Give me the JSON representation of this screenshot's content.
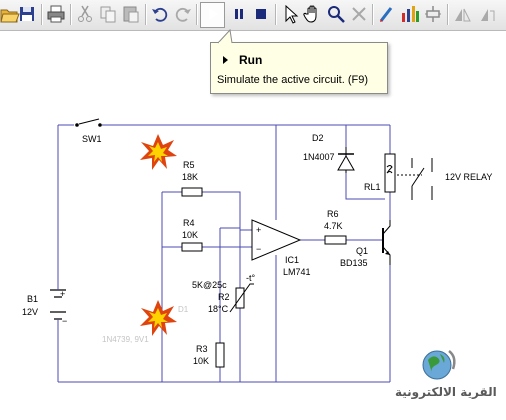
{
  "toolbar": {
    "icons": [
      "open-icon",
      "save-icon",
      "print-icon",
      "cut-icon",
      "copy-icon",
      "paste-icon",
      "undo-icon",
      "redo-icon",
      "run-icon",
      "pause-icon",
      "stop-icon",
      "select-arrow-icon",
      "pan-hand-icon",
      "zoom-icon",
      "delete-icon",
      "wire-icon",
      "graph-icon",
      "components-icon",
      "flip-icon",
      "rotate-icon"
    ]
  },
  "tooltip": {
    "title": "Run",
    "description": "Simulate the active circuit. (F9)"
  },
  "circuit": {
    "sw1": "SW1",
    "b1_name": "B1",
    "b1_value": "12V",
    "r5_name": "R5",
    "r5_value": "18K",
    "r4_name": "R4",
    "r4_value": "10K",
    "r2_name": "R2",
    "r2_temp": "5K@25c",
    "r2_value": "18°C",
    "r3_name": "R3",
    "r3_value": "10K",
    "zener_label": "1N4739, 9V1",
    "zener_name": "D1",
    "ic1_name": "IC1",
    "ic1_value": "LM741",
    "r6_name": "R6",
    "r6_value": "4.7K",
    "q1_name": "Q1",
    "q1_value": "BD135",
    "d2_name": "D2",
    "d2_value": "1N4007",
    "rl1_name": "RL1",
    "relay_label": "12V RELAY",
    "plus": "+",
    "minus": "−",
    "t_sym": "-t°"
  },
  "watermark": {
    "text": "القرية الالكترونية"
  },
  "colors": {
    "wire": "#4b4bb4",
    "component": "#000000",
    "spark_outer": "#e0440e",
    "spark_inner": "#ffd200",
    "tooltip_bg": "#ffffe6"
  }
}
